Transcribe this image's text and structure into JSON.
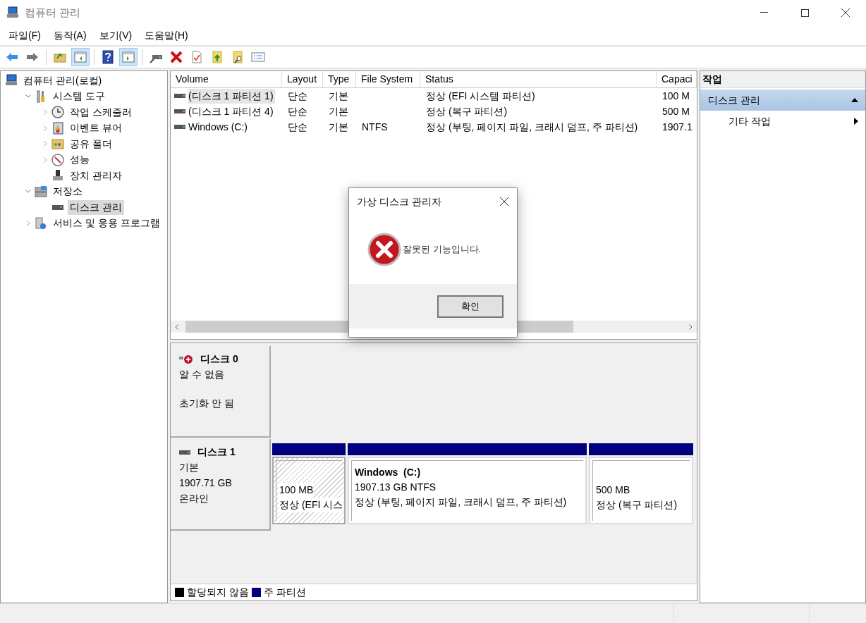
{
  "window": {
    "title": "컴퓨터 관리"
  },
  "menu": [
    "파일(F)",
    "동작(A)",
    "보기(V)",
    "도움말(H)"
  ],
  "toolbar": [
    [
      {
        "kind": "back",
        "pressed": false
      },
      {
        "kind": "forward",
        "pressed": false
      }
    ],
    [
      {
        "kind": "up",
        "pressed": false
      },
      {
        "kind": "tree",
        "pressed": true
      }
    ],
    [
      {
        "kind": "help",
        "pressed": false
      },
      {
        "kind": "pane",
        "pressed": true
      }
    ],
    [
      {
        "kind": "drive",
        "pressed": false
      },
      {
        "kind": "delete",
        "pressed": false
      },
      {
        "kind": "check",
        "pressed": false
      },
      {
        "kind": "upload",
        "pressed": false
      },
      {
        "kind": "find",
        "pressed": false
      },
      {
        "kind": "list",
        "pressed": false
      }
    ]
  ],
  "tree": [
    {
      "label": "컴퓨터 관리(로컬)",
      "selected": false,
      "children": [
        {
          "label": "시스템 도구",
          "expanded": true,
          "selected": false,
          "children": [
            {
              "label": "작업 스케줄러",
              "expanded": false,
              "selected": false
            },
            {
              "label": "이벤트 뷰어",
              "expanded": false,
              "selected": false
            },
            {
              "label": "공유 폴더",
              "expanded": false,
              "selected": false
            },
            {
              "label": "성능",
              "expanded": false,
              "selected": false
            },
            {
              "label": "장치 관리자",
              "selected": false
            }
          ]
        },
        {
          "label": "저장소",
          "expanded": true,
          "selected": false,
          "children": [
            {
              "label": "디스크 관리",
              "selected": true
            }
          ]
        },
        {
          "label": "서비스 및 응용 프로그램",
          "expanded": false,
          "selected": false
        }
      ]
    }
  ],
  "volumes": {
    "columns": [
      "Volume",
      "Layout",
      "Type",
      "File System",
      "Status",
      "Capaci"
    ],
    "rows": [
      {
        "selected": true,
        "cells": [
          "(디스크 1 파티션 1)",
          "단순",
          "기본",
          "",
          "정상 (EFI 시스템 파티션)",
          "100 M"
        ]
      },
      {
        "selected": false,
        "cells": [
          "(디스크 1 파티션 4)",
          "단순",
          "기본",
          "",
          "정상 (복구 파티션)",
          "500 M"
        ]
      },
      {
        "selected": false,
        "cells": [
          "Windows (C:)",
          "단순",
          "기본",
          "NTFS",
          "정상 (부팅, 페이지 파일, 크래시 덤프, 주 파티션)",
          "1907.1"
        ]
      }
    ]
  },
  "disks": [
    {
      "kind": "unknown",
      "name": "디스크 0",
      "type": "알 수 없음",
      "status": "초기화 안 됨"
    },
    {
      "kind": "basic",
      "name": "디스크 1",
      "type": "기본",
      "size": "1907.71 GB",
      "status": "온라인",
      "partitions": [
        {
          "selected": true,
          "size": "100 MB",
          "status": "정상 (EFI 시스"
        },
        {
          "selected": false,
          "label": "Windows  (C:)",
          "size": "1907.13 GB NTFS",
          "status": "정상 (부팅, 페이지 파일, 크래시 덤프, 주 파티션)"
        },
        {
          "selected": false,
          "size": "500 MB",
          "status": "정상 (복구 파티션)"
        }
      ]
    }
  ],
  "legend": [
    {
      "label": "할당되지 않음",
      "color": "#000000"
    },
    {
      "label": "주 파티션",
      "color": "#000080"
    }
  ],
  "actions": {
    "header": "작업",
    "section": "디스크 관리",
    "expanded": true,
    "items": [
      "기타 작업"
    ]
  },
  "dialog": {
    "title": "가상 디스크 관리자",
    "message": "잘못된 기능입니다.",
    "button": "확인"
  }
}
